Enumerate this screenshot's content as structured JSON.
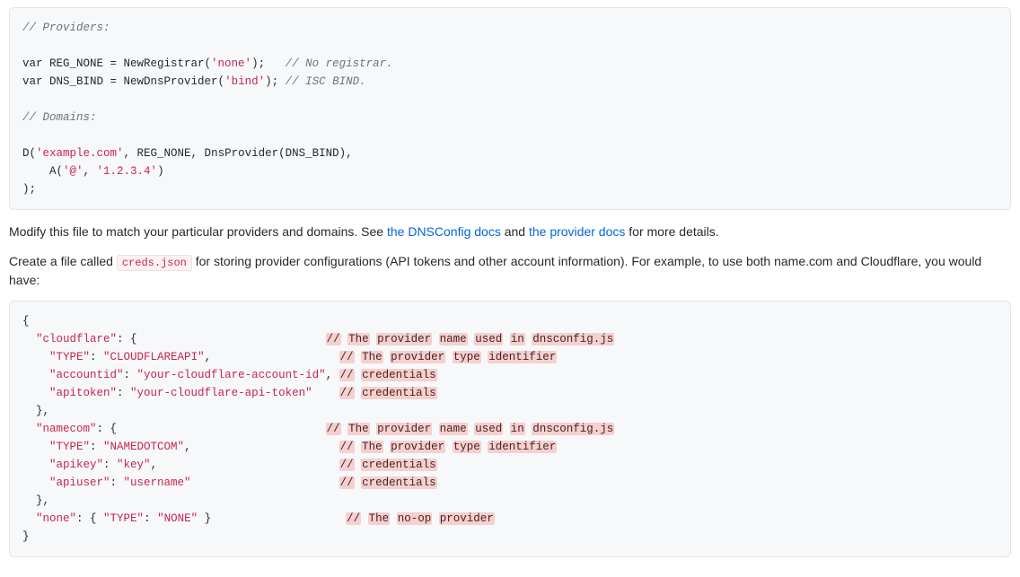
{
  "code1": {
    "c1": "// Providers:",
    "l1a": "var",
    "l1b": " REG_NONE = NewRegistrar(",
    "l1c": "'none'",
    "l1d": ");   ",
    "l1e": "// No registrar.",
    "l2a": "var",
    "l2b": " DNS_BIND = NewDnsProvider(",
    "l2c": "'bind'",
    "l2d": "); ",
    "l2e": "// ISC BIND.",
    "c2": "// Domains:",
    "l3a": "D(",
    "l3b": "'example.com'",
    "l3c": ", REG_NONE, DnsProvider(DNS_BIND),",
    "l4a": "    A(",
    "l4b": "'@'",
    "l4c": ", ",
    "l4d": "'1.2.3.4'",
    "l4e": ")",
    "l5": ");"
  },
  "para1": {
    "t1": "Modify this file to match your particular providers and domains. See ",
    "link1": "the DNSConfig docs",
    "t2": " and ",
    "link2": "the provider docs",
    "t3": " for more details."
  },
  "para2": {
    "t1": "Create a file called ",
    "code": "creds.json",
    "t2": " for storing provider configurations (API tokens and other account information). For example, to use both name.com and Cloudflare, you would have:"
  },
  "code2": {
    "open": "{",
    "cf_open_a": "  ",
    "cf_open_b": "\"cloudflare\"",
    "cf_open_c": ": {                            ",
    "cf_open_cm_sl": "//",
    "cf_open_cm_w": [
      "The",
      "provider",
      "name",
      "used",
      "in",
      "dnsconfig.js"
    ],
    "cf_type_a": "    ",
    "cf_type_b": "\"TYPE\"",
    "cf_type_c": ": ",
    "cf_type_d": "\"CLOUDFLAREAPI\"",
    "cf_type_e": ",                   ",
    "cf_type_cm_sl": "//",
    "cf_type_cm_w": [
      "The",
      "provider",
      "type",
      "identifier"
    ],
    "cf_acc_a": "    ",
    "cf_acc_b": "\"accountid\"",
    "cf_acc_c": ": ",
    "cf_acc_d": "\"your-cloudflare-account-id\"",
    "cf_acc_e": ", ",
    "cf_acc_cm_sl": "//",
    "cf_acc_cm_w": [
      "credentials"
    ],
    "cf_tok_a": "    ",
    "cf_tok_b": "\"apitoken\"",
    "cf_tok_c": ": ",
    "cf_tok_d": "\"your-cloudflare-api-token\"",
    "cf_tok_e": "    ",
    "cf_tok_cm_sl": "//",
    "cf_tok_cm_w": [
      "credentials"
    ],
    "cf_close": "  },",
    "nc_open_a": "  ",
    "nc_open_b": "\"namecom\"",
    "nc_open_c": ": {                               ",
    "nc_open_cm_sl": "//",
    "nc_open_cm_w": [
      "The",
      "provider",
      "name",
      "used",
      "in",
      "dnsconfig.js"
    ],
    "nc_type_a": "    ",
    "nc_type_b": "\"TYPE\"",
    "nc_type_c": ": ",
    "nc_type_d": "\"NAMEDOTCOM\"",
    "nc_type_e": ",                      ",
    "nc_type_cm_sl": "//",
    "nc_type_cm_w": [
      "The",
      "provider",
      "type",
      "identifier"
    ],
    "nc_key_a": "    ",
    "nc_key_b": "\"apikey\"",
    "nc_key_c": ": ",
    "nc_key_d": "\"key\"",
    "nc_key_e": ",                           ",
    "nc_key_cm_sl": "//",
    "nc_key_cm_w": [
      "credentials"
    ],
    "nc_usr_a": "    ",
    "nc_usr_b": "\"apiuser\"",
    "nc_usr_c": ": ",
    "nc_usr_d": "\"username\"",
    "nc_usr_e": "                      ",
    "nc_usr_cm_sl": "//",
    "nc_usr_cm_w": [
      "credentials"
    ],
    "nc_close": "  },",
    "none_a": "  ",
    "none_b": "\"none\"",
    "none_c": ": { ",
    "none_d": "\"TYPE\"",
    "none_e": ": ",
    "none_f": "\"NONE\"",
    "none_g": " }                    ",
    "none_cm_sl": "//",
    "none_cm_w": [
      "The",
      "no-op",
      "provider"
    ],
    "close": "}"
  }
}
